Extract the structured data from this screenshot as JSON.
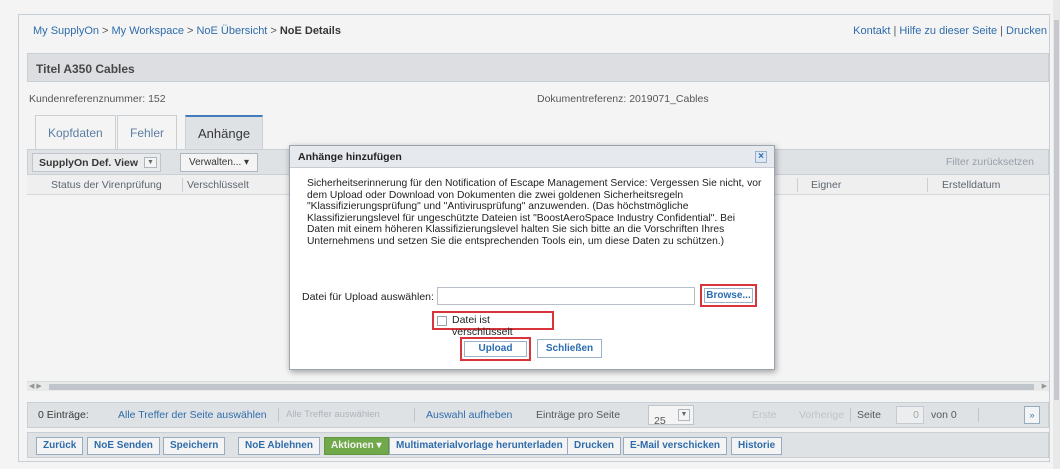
{
  "breadcrumb": {
    "items": [
      "My SupplyOn",
      "My Workspace",
      "NoE Übersicht"
    ],
    "separator": ">",
    "current": "NoE Details"
  },
  "top_links": {
    "kontakt": "Kontakt",
    "hilfe": "Hilfe zu dieser Seite",
    "drucken": "Drucken",
    "separator": "|"
  },
  "title": "Titel A350 Cables",
  "meta": {
    "kundenreferenz": "Kundenreferenznummer: 152",
    "dokumentreferenz": "Dokumentreferenz: 2019071_Cables"
  },
  "tabs": [
    {
      "label": "Kopfdaten",
      "active": false
    },
    {
      "label": "Fehler",
      "active": false
    },
    {
      "label": "Anhänge",
      "active": true
    }
  ],
  "grid_toolbar": {
    "view": "SupplyOn Def. View",
    "manage": "Verwalten... ▾",
    "filter_reset": "Filter zurücksetzen"
  },
  "columns": [
    "Status der Virenprüfung",
    "Verschlüsselt",
    "Eigner",
    "Erstelldatum"
  ],
  "pager": {
    "entries": "0 Einträge:",
    "select_all_page": "Alle Treffer der Seite auswählen",
    "select_all": "Alle Treffer auswählen",
    "clear_selection": "Auswahl aufheben",
    "per_page_label": "Einträge pro Seite",
    "per_page": "25",
    "first": "Erste",
    "previous": "Vorherige",
    "page_label": "Seite",
    "page": "0",
    "of": "von 0",
    "next": "»"
  },
  "actions": {
    "zurueck": "Zurück",
    "noe_senden": "NoE Senden",
    "speichern": "Speichern",
    "noe_ablehnen": "NoE Ablehnen",
    "aktionen": "Aktionen ▾",
    "multimaterial": "Multimaterialvorlage herunterladen",
    "drucken": "Drucken",
    "email": "E-Mail verschicken",
    "historie": "Historie"
  },
  "dialog": {
    "title": "Anhänge hinzufügen",
    "close": "×",
    "message": "Sicherheitserinnerung für den Notification of Escape Management Service: Vergessen Sie nicht, vor dem Upload oder Download von Dokumenten die zwei goldenen Sicherheitsregeln \"Klassifizierungsprüfung\" und \"Antivirusprüfung\" anzuwenden. (Das höchstmögliche Klassifizierungslevel für ungeschützte Dateien ist \"BoostAeroSpace Industry Confidential\". Bei Daten mit einem höheren Klassifizierungslevel halten Sie sich bitte an die Vorschriften Ihres Unternehmens und setzen Sie die entsprechenden Tools ein, um diese Daten zu schützen.)",
    "file_label": "Datei für Upload auswählen:",
    "file_value": "",
    "browse": "Browse...",
    "encrypted_label": "Datei ist verschlüsselt",
    "encrypted_checked": false,
    "upload": "Upload",
    "schliessen": "Schließen"
  },
  "colors": {
    "link": "#2a6cb0",
    "highlight": "#d9343b",
    "green_button": "#70ad47",
    "toolbar_bg": "#e9ecef"
  }
}
